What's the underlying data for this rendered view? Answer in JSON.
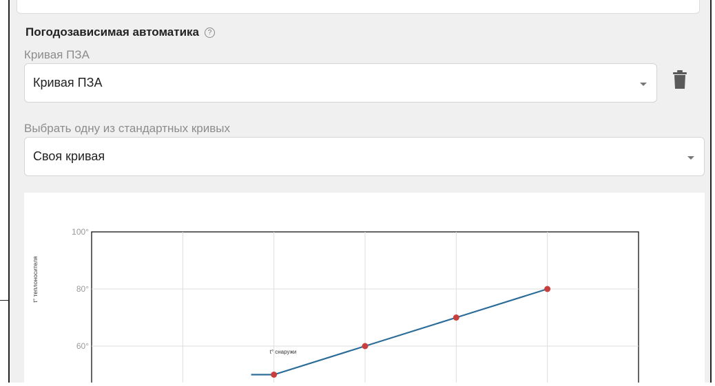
{
  "section": {
    "title": "Погодозависимая автоматика",
    "help_icon": "help-circle-icon"
  },
  "curve_field": {
    "label": "Кривая ПЗА",
    "value": "Кривая ПЗА",
    "delete_icon": "trash-icon"
  },
  "standard_field": {
    "label": "Выбрать одну из стандартных кривых",
    "value": "Своя кривая"
  },
  "chart_data": {
    "type": "line",
    "ylabel": "t° теплоносителя",
    "annotation": "t° снаружи",
    "yticks": [
      "100°",
      "80°",
      "60°"
    ],
    "ylim": [
      50,
      100
    ],
    "xlim": [
      0,
      6
    ],
    "points": [
      {
        "x": 1.75,
        "y": 50
      },
      {
        "x": 2,
        "y": 50
      },
      {
        "x": 3,
        "y": 60
      },
      {
        "x": 4,
        "y": 70
      },
      {
        "x": 5,
        "y": 80
      }
    ],
    "colors": {
      "line": "#2b6c99",
      "marker": "#c8403e"
    }
  }
}
